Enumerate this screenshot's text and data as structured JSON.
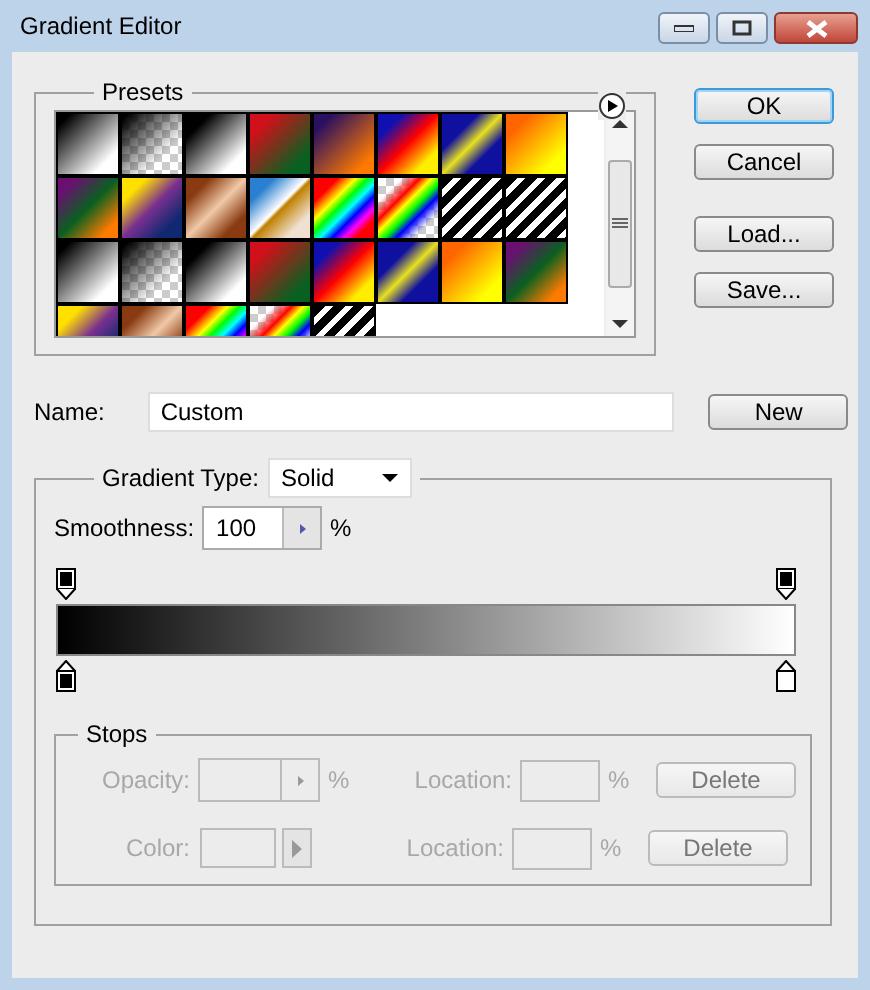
{
  "window": {
    "title": "Gradient Editor"
  },
  "presets": {
    "title": "Presets"
  },
  "buttons": [
    {
      "label": "OK",
      "default": true
    },
    {
      "label": "Cancel",
      "default": false
    },
    {
      "label": "Load...",
      "default": false
    },
    {
      "label": "Save...",
      "default": false
    }
  ],
  "name_field": {
    "label": "Name:",
    "value": "Custom",
    "button": "New"
  },
  "gradient": {
    "type_label": "Gradient Type:",
    "type_value": "Solid",
    "smoothness_label": "Smoothness:",
    "smoothness_value": "100",
    "smoothness_unit": "%",
    "color_stops": [
      {
        "color": "#000000"
      },
      {
        "color": "#ffffff"
      }
    ]
  },
  "stops": {
    "title": "Stops",
    "rows": [
      {
        "kind": "opacity",
        "label": "Opacity:",
        "unit": "%",
        "location_label": "Location:",
        "location_unit": "%",
        "button": "Delete",
        "disabled": true
      },
      {
        "kind": "color",
        "label": "Color:",
        "location_label": "Location:",
        "location_unit": "%",
        "button": "Delete",
        "disabled": true
      }
    ]
  }
}
